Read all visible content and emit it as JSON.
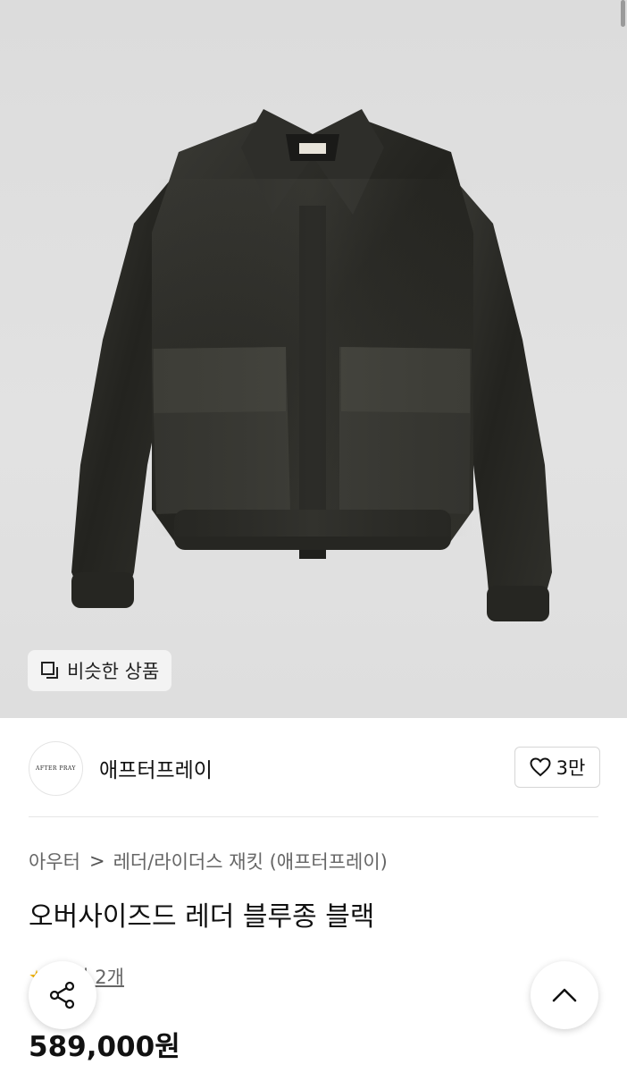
{
  "product_image": {
    "alt": "AFTER PRAY leather blouson jacket"
  },
  "similar_button": {
    "label": "비슷한 상품",
    "icon": "similar-items-icon"
  },
  "brand": {
    "logo_text": "AFTER PRAY",
    "name": "애프터프레이"
  },
  "like": {
    "count": "3만",
    "icon": "heart-icon"
  },
  "breadcrumb": {
    "category": "아우터",
    "subcategory": "레더/라이더스 재킷 (애프터프레이)",
    "separator": ">"
  },
  "product": {
    "title": "오버사이즈드 레더 블루종 블랙",
    "review_label": "후기 2개",
    "rating_stars": "★",
    "price": "589,000원"
  },
  "fabs": {
    "share_icon": "share-icon",
    "top_icon": "chevron-up-icon"
  },
  "colors": {
    "leather": "#2b2b27",
    "background": "#dfdfdf",
    "star": "#f2b200"
  }
}
